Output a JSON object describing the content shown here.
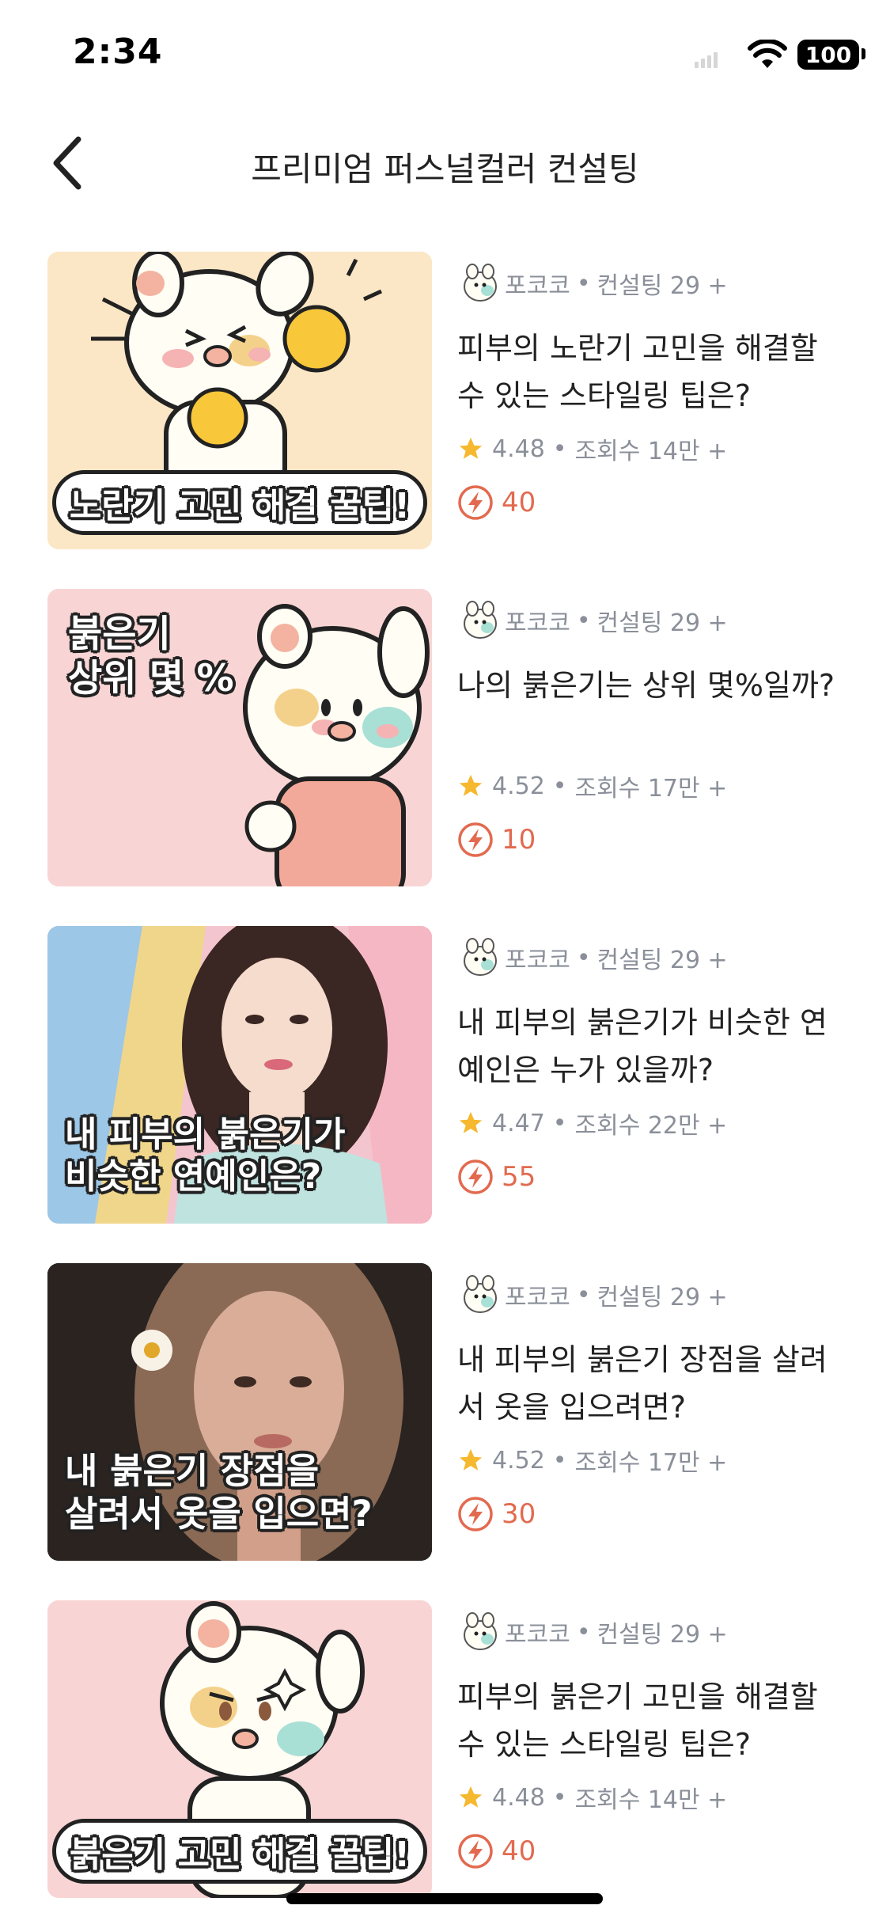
{
  "status_bar": {
    "time": "2:34",
    "battery": "100"
  },
  "nav": {
    "title": "프리미엄 퍼스널컬러 컨설팅"
  },
  "items": [
    {
      "thumb_text": "노란기 고민 해결 꿀팁!",
      "author": "포코코",
      "category": "컨설팅 29 +",
      "title": "피부의 노란기 고민을 해결할 수 있는 스타일링 팁은?",
      "rating": "4.48",
      "views": "조회수 14만 +",
      "cost": "40"
    },
    {
      "thumb_text": "붉은기\n상위 몇 %",
      "author": "포코코",
      "category": "컨설팅 29 +",
      "title": "나의 붉은기는 상위 몇%일까?",
      "rating": "4.52",
      "views": "조회수 17만 +",
      "cost": "10"
    },
    {
      "thumb_text": "내 피부의 붉은기가\n비슷한 연예인은?",
      "author": "포코코",
      "category": "컨설팅 29 +",
      "title": "내 피부의 붉은기가 비슷한 연예인은 누가 있을까?",
      "rating": "4.47",
      "views": "조회수 22만 +",
      "cost": "55"
    },
    {
      "thumb_text": "내 붉은기 장점을\n살려서 옷을 입으면?",
      "author": "포코코",
      "category": "컨설팅 29 +",
      "title": "내 피부의 붉은기 장점을 살려서 옷을 입으려면?",
      "rating": "4.52",
      "views": "조회수 17만 +",
      "cost": "30"
    },
    {
      "thumb_text": "붉은기 고민 해결 꿀팁!",
      "author": "포코코",
      "category": "컨설팅 29 +",
      "title": "피부의 붉은기 고민을 해결할 수 있는 스타일링 팁은?",
      "rating": "4.48",
      "views": "조회수 14만 +",
      "cost": "40"
    }
  ],
  "icons": {
    "star": "star-icon",
    "bolt": "bolt-icon",
    "back": "chevron-left-icon"
  },
  "colors": {
    "accent": "#e26a4f",
    "star": "#f5b82e",
    "meta": "#8a8f99"
  }
}
